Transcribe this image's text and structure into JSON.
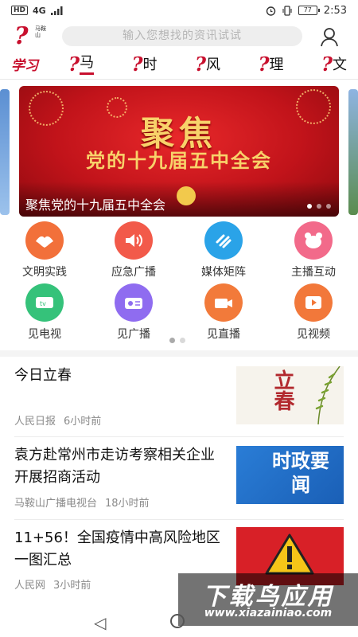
{
  "status_bar": {
    "network": "HD",
    "signal": "4G",
    "battery": "77",
    "time": "2:53"
  },
  "header": {
    "logo_sub": "马鞍山",
    "logo_learn": "学习",
    "logo_mark": "?",
    "search_placeholder": "输入您想找的资讯试试"
  },
  "tabs": [
    {
      "mark": "?",
      "label": "马",
      "active": true
    },
    {
      "mark": "?",
      "label": "时"
    },
    {
      "mark": "?",
      "label": "风"
    },
    {
      "mark": "?",
      "label": "理"
    },
    {
      "mark": "?",
      "label": "文"
    }
  ],
  "banner": {
    "headline1": "聚焦",
    "headline2": "党的十九届五中全会",
    "caption": "聚焦党的十九届五中全会"
  },
  "grid": [
    {
      "label": "文明实践",
      "icon": "hands-icon",
      "color": "#f2703a"
    },
    {
      "label": "应急广播",
      "icon": "speaker-icon",
      "color": "#f25a4a"
    },
    {
      "label": "媒体矩阵",
      "icon": "matrix-icon",
      "color": "#2aa3e8"
    },
    {
      "label": "主播互动",
      "icon": "bear-icon",
      "color": "#f26a8a"
    },
    {
      "label": "见电视",
      "icon": "tv-icon",
      "color": "#35c27a"
    },
    {
      "label": "见广播",
      "icon": "radio-icon",
      "color": "#8f6cf0"
    },
    {
      "label": "见直播",
      "icon": "camera-icon",
      "color": "#f27a3a"
    },
    {
      "label": "见视频",
      "icon": "play-icon",
      "color": "#f2783a"
    }
  ],
  "news": [
    {
      "title": "今日立春",
      "source": "人民日报",
      "time": "6小时前",
      "thumb_text": "立春"
    },
    {
      "title": "袁方赴常州市走访考察相关企业开展招商活动",
      "source": "马鞍山广播电视台",
      "time": "18小时前",
      "thumb_text": "时政要闻"
    },
    {
      "title": "11+56！全国疫情中高风险地区一图汇总",
      "source": "人民网",
      "time": "3小时前",
      "thumb_text": ""
    }
  ],
  "watermark": {
    "big": "下载鸟应用",
    "url": "www.xiazainiao.com"
  },
  "colors": {
    "brand_red": "#c8102e",
    "banner_red": "#c1131a",
    "gold": "#f8d26a"
  }
}
